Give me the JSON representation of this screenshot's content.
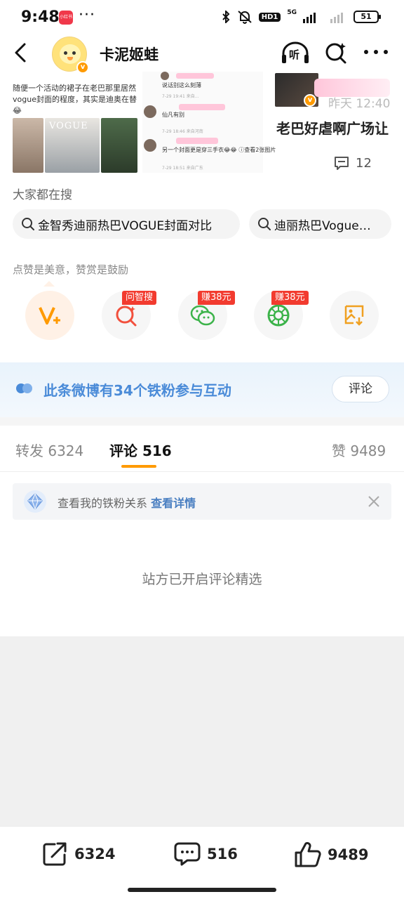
{
  "status_bar": {
    "time": "9:48",
    "app_badge": "小红书",
    "network": "5G",
    "hd_label": "HD1",
    "battery": "51"
  },
  "nav": {
    "title": "卡泥姬蛙",
    "listen_label": "听"
  },
  "cards": {
    "left_text": "随便一个活动的裙子在老巴那里居然vogue封面的程度，其实是迪奥在替😂",
    "vogue_text": "VOGUE",
    "comment_lines": [
      "说话别这么刻薄",
      "仙凡有别",
      "另一个封面更是穿三手衣😂😂 ⓘ查看2张图片"
    ],
    "comment_meta": [
      "7-29 19:41 来自…",
      "7-29 18:46 来自河南",
      "7-29 18:51 来自广东"
    ],
    "right_time": "昨天 12:40",
    "right_title": "老巴好虐啊广场让",
    "right_count": "12"
  },
  "search": {
    "label": "大家都在搜",
    "chips": [
      "金智秀迪丽热巴VOGUE封面对比",
      "迪丽热巴Vogue…"
    ]
  },
  "reward": {
    "label": "点赞是美意，赞赏是鼓励",
    "tags": [
      "问智搜",
      "赚38元",
      "赚38元"
    ]
  },
  "fans": {
    "text": "此条微博有34个铁粉参与互动",
    "button": "评论"
  },
  "tabs": {
    "repost_label": "转发",
    "repost_count": "6324",
    "comment_label": "评论",
    "comment_count": "516",
    "like_label": "赞",
    "like_count": "9489"
  },
  "notice": {
    "text": "查看我的铁粉关系",
    "link": "查看详情"
  },
  "selected_note": "站方已开启评论精选",
  "bottom_bar": {
    "repost": "6324",
    "comment": "516",
    "like": "9489"
  },
  "colors": {
    "accent": "#ff9a00",
    "link_blue": "#4a8bd8",
    "tag_red": "#f23b2f"
  }
}
